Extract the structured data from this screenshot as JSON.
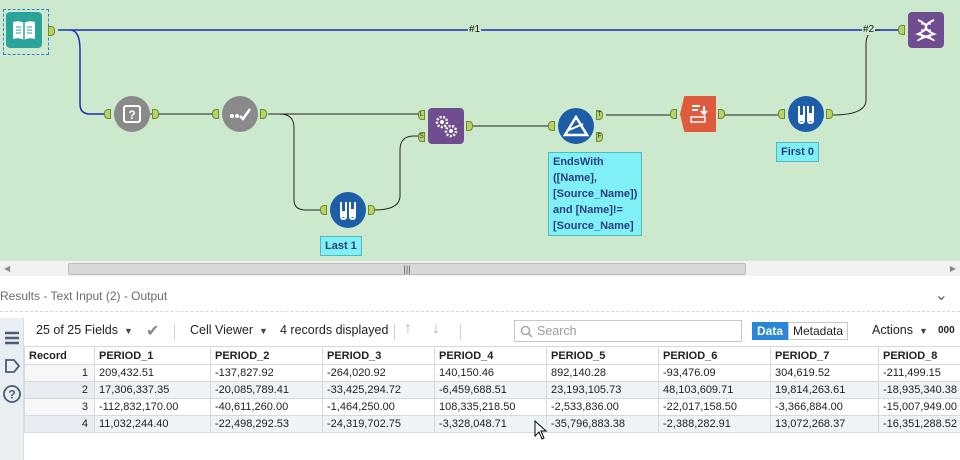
{
  "workflow": {
    "connection_labels": [
      "#1",
      "#2"
    ],
    "annotations": {
      "last": "Last 1",
      "first": "First 0",
      "formula": [
        "EndsWith",
        "([Name],",
        "[Source_Name])",
        "and [Name]!=",
        "[Source_Name]"
      ]
    },
    "anchor_labels": {
      "true": "T",
      "false": "F",
      "left": "L",
      "source": "S"
    }
  },
  "results": {
    "title": "Results - Text Input (2) - Output",
    "fields_count": "25 of 25 Fields",
    "cell_viewer": "Cell Viewer",
    "records_displayed": "4 records displayed",
    "search_placeholder": "Search",
    "tab_data": "Data",
    "tab_metadata": "Metadata",
    "actions": "Actions",
    "more": "000"
  },
  "table": {
    "columns": [
      "Record",
      "PERIOD_1",
      "PERIOD_2",
      "PERIOD_3",
      "PERIOD_4",
      "PERIOD_5",
      "PERIOD_6",
      "PERIOD_7",
      "PERIOD_8"
    ],
    "rows": [
      [
        "1",
        "209,432.51",
        "-137,827.92",
        "-264,020.92",
        "140,150.46",
        "892,140.28",
        "-93,476.09",
        "304,619.52",
        "-211,499.15"
      ],
      [
        "2",
        "17,306,337.35",
        "-20,085,789.41",
        "-33,425,294.72",
        "-6,459,688.51",
        "23,193,105.73",
        "48,103,609.71",
        "19,814,263.61",
        "-18,935,340.38"
      ],
      [
        "3",
        "-112,832,170.00",
        "-40,611,260.00",
        "-1,464,250.00",
        "108,335,218.50",
        "-2,533,836.00",
        "-22,017,158.50",
        "-3,366,884.00",
        "-15,007,949.00"
      ],
      [
        "4",
        "11,032,244.40",
        "-22,498,292.53",
        "-24,319,702.75",
        "-3,328,048.71",
        "-35,796,883.38",
        "-2,388,282.91",
        "13,072,268.37",
        "-16,351,288.52"
      ]
    ]
  },
  "colors": {
    "canvas": "#cde9cd",
    "wire_primary": "#1c2fb4",
    "wire": "#222222",
    "annotation": "#7ff0f6",
    "accent": "#2a86d8"
  }
}
